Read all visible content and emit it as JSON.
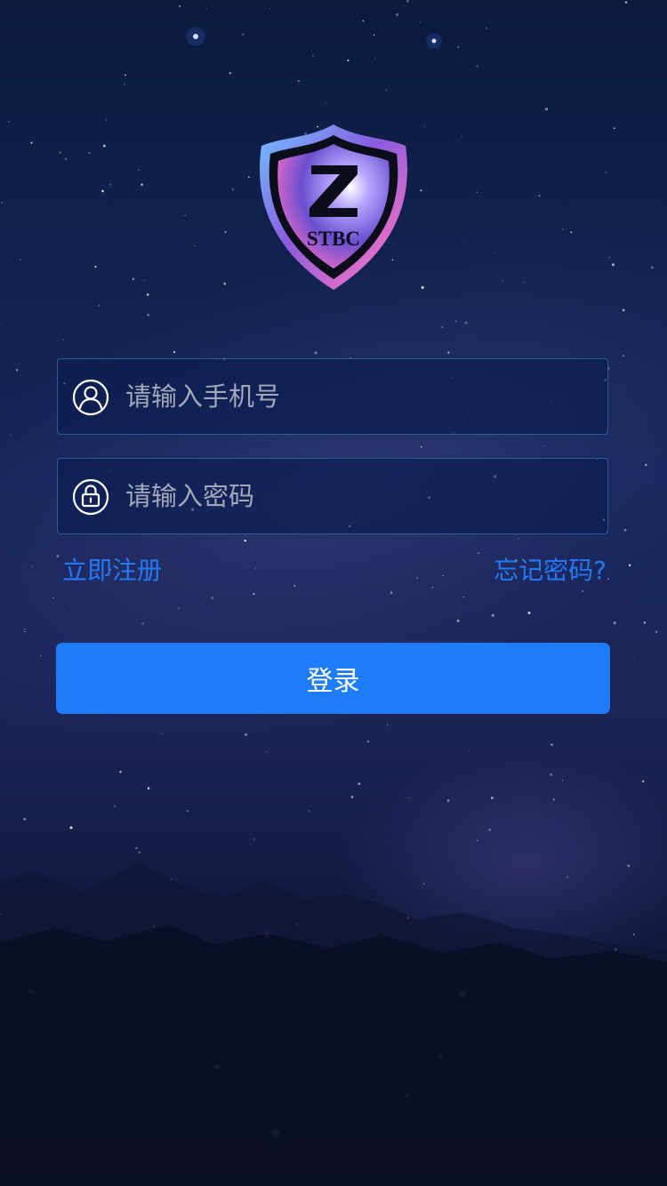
{
  "logo": {
    "text": "STBC",
    "letter": "Z"
  },
  "phone": {
    "placeholder": "请输入手机号",
    "value": ""
  },
  "password": {
    "placeholder": "请输入密码",
    "value": ""
  },
  "links": {
    "register": "立即注册",
    "forgot": "忘记密码?"
  },
  "login": {
    "label": "登录"
  },
  "colors": {
    "accent": "#1f7cf8",
    "link": "#2479f5",
    "placeholder": "#a2a8b9"
  },
  "icons": {
    "phone": "user-icon",
    "password": "lock-icon"
  }
}
